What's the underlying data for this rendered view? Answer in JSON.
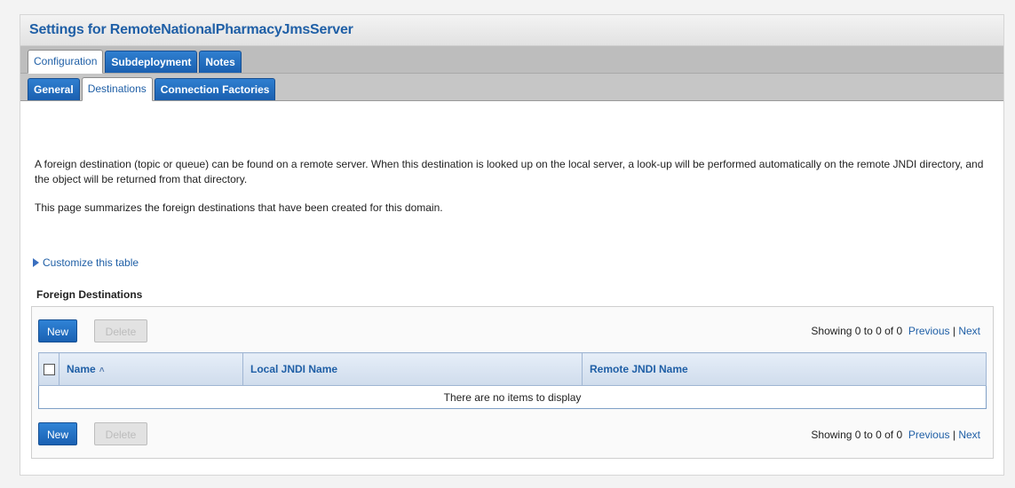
{
  "page_title": "Settings for RemoteNationalPharmacyJmsServer",
  "tabs_primary": [
    {
      "label": "Configuration",
      "active": true
    },
    {
      "label": "Subdeployment",
      "active": false
    },
    {
      "label": "Notes",
      "active": false
    }
  ],
  "tabs_secondary": [
    {
      "label": "General",
      "active": false
    },
    {
      "label": "Destinations",
      "active": true
    },
    {
      "label": "Connection Factories",
      "active": false
    }
  ],
  "description": {
    "para1": "A foreign destination (topic or queue) can be found on a remote server. When this destination is looked up on the local server, a look-up will be performed automatically on the remote JNDI directory, and the object will be returned from that directory.",
    "para2": "This page summarizes the foreign destinations that have been created for this domain."
  },
  "customize_link": "Customize this table",
  "table": {
    "title": "Foreign Destinations",
    "new_label": "New",
    "delete_label": "Delete",
    "paging_text": "Showing 0 to 0 of 0",
    "previous_label": "Previous",
    "separator": "|",
    "next_label": "Next",
    "columns": [
      "Name",
      "Local JNDI Name",
      "Remote JNDI Name"
    ],
    "empty_message": "There are no items to display"
  },
  "colors": {
    "accent": "#1f5fa6",
    "button_blue": "#1a61b3",
    "tab_bar_gray": "#bdbdbd"
  },
  "icons": [
    "expand-triangle-icon",
    "sort-ascending-icon",
    "select-all-checkbox"
  ]
}
